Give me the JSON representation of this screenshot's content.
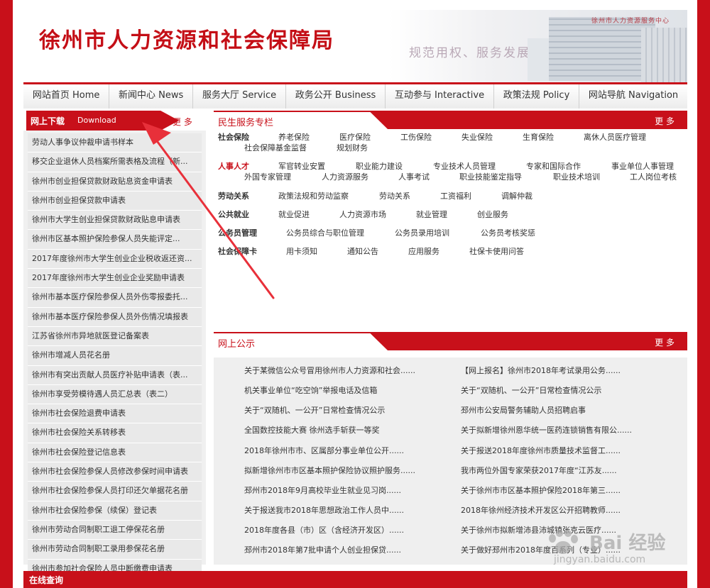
{
  "header": {
    "site_title": "徐州市人力资源和社会保障局",
    "slogan": "规范用权、服务发展",
    "building_name": "徐州市人力资源服务中心"
  },
  "nav": [
    "网站首页 Home",
    "新闻中心 News",
    "服务大厅 Service",
    "政务公开 Business",
    "互动参与 Interactive",
    "政策法规 Policy",
    "网站导航 Navigation"
  ],
  "download": {
    "title": "网上下载",
    "title_en": "Download",
    "more": "更 多",
    "items": [
      "劳动人事争议仲裁申请书样本",
      "移交企业退休人员档案所需表格及流程（新...",
      "徐州市创业担保贷款财政贴息资金申请表",
      "徐州市创业担保贷款申请表",
      "徐州市大学生创业担保贷款财政贴息申请表",
      "徐州市区基本照护保险参保人员失能评定...",
      "2017年度徐州市大学生创业企业税收返还资...",
      "2017年度徐州市大学生创业企业奖励申请表",
      "徐州市基本医疗保险参保人员外伤零报委托...",
      "徐州市基本医疗保险参保人员外伤情况填报表",
      "江苏省徐州市异地就医登记备案表",
      "徐州市增减人员花名册",
      "徐州市有突出贡献人员医疗补贴申请表（表...",
      "徐州市享受劳模待遇人员汇总表（表二）",
      "徐州市社会保险退费申请表",
      "徐州市社会保险关系转移表",
      "徐州市社会保险登记信息表",
      "徐州市社会保险参保人员修改参保时间申请表",
      "徐州市社会保险参保人员打印还欠单据花名册",
      "徐州市社会保险参保（续保）登记表",
      "徐州市劳动合同制职工退工停保花名册",
      "徐州市劳动合同制职工录用参保花名册",
      "徐州市参加社会保险人员中断缴费申请表"
    ]
  },
  "services": {
    "title": "民生服务专栏",
    "more": "更 多",
    "social_insurance": {
      "label": "社会保险",
      "links": [
        "养老保险",
        "医疗保险",
        "工伤保险",
        "失业保险",
        "生育保险",
        "离休人员医疗管理",
        "社会保障基金监督",
        "规划财务"
      ]
    },
    "talent": {
      "label": "人事人才",
      "links": [
        "军官转业安置",
        "职业能力建设",
        "专业技术人员管理",
        "专家和国际合作",
        "事业单位人事管理",
        "外国专家管理",
        "人力资源服务",
        "人事考试",
        "职业技能鉴定指导",
        "职业技术培训",
        "工人岗位考核"
      ]
    },
    "labor": {
      "label": "劳动关系",
      "links": [
        "政策法规和劳动监察",
        "劳动关系",
        "工资福利",
        "调解仲裁"
      ]
    },
    "employment": {
      "label": "公共就业",
      "links": [
        "就业促进",
        "人力资源市场",
        "就业管理",
        "创业服务"
      ]
    },
    "civil_servant": {
      "label": "公务员管理",
      "links": [
        "公务员综合与职位管理",
        "公务员录用培训",
        "公务员考核奖惩"
      ]
    },
    "card": {
      "label": "社会保障卡",
      "links": [
        "用卡须知",
        "通知公告",
        "应用服务",
        "社保卡使用问答"
      ]
    }
  },
  "announcements": {
    "title": "网上公示",
    "more": "更 多",
    "left": [
      "关于某微信公众号冒用徐州市人力资源和社会......",
      "机关事业单位“吃空饷”举报电话及信箱",
      "关于“双随机、一公开”日常检查情况公示",
      "全国数控技能大赛 徐州选手斩获一等奖",
      "2018年徐州市市、区属部分事业单位公开......",
      "拟新增徐州市市区基本照护保险协议照护服务......",
      "邳州市2018年9月高校毕业生就业见习岗......",
      "关于报送我市2018年思想政治工作人员中......",
      "2018年度各县（市）区（含经济开发区）......",
      "邳州市2018年第7批申请个人创业担保贷......"
    ],
    "right": [
      "【网上报名】徐州市2018年考试录用公务......",
      "关于“双随机、一公开”日常检查情况公示",
      "邳州市公安局警务辅助人员招聘启事",
      "关于拟新增徐州恩华统一医药连锁销售有限公......",
      "关于报送2018年度徐州市质量技术监督工......",
      "我市两位外国专家荣获2017年度“江苏友......",
      "关于徐州市市区基本照护保险2018年第三......",
      "2018年徐州经济技术开发区公开招聘教师......",
      "关于徐州市拟新增沛县沛城镇张克云医疗......",
      "关于做好邳州市2018年度百系列（专业）......"
    ]
  },
  "bottom": {
    "title": "在线查询"
  },
  "watermark": {
    "brand": "Bai 经验",
    "url": "jingyan.baidu.com"
  },
  "colors": {
    "brand_red": "#c8101a",
    "arrow_red": "#e8303a"
  }
}
